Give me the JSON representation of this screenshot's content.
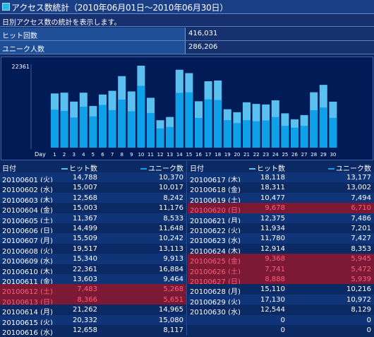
{
  "header": {
    "title": "アクセス数統計（2010年06月01日〜2010年06月30日）",
    "description": "日別アクセス数の統計を表示します。"
  },
  "summary": {
    "hits_label": "ヒット回数",
    "hits_value": "416,031",
    "unique_label": "ユニーク人数",
    "unique_value": "286,206"
  },
  "colors": {
    "hits": "#5ac0f0",
    "unique": "#0ea0e8",
    "highlight": "#7c1a35"
  },
  "chart_data": {
    "type": "bar",
    "ymax_label": "22361",
    "xlabel": "Day",
    "ylim": [
      0,
      22361
    ],
    "categories": [
      "1",
      "2",
      "3",
      "4",
      "5",
      "6",
      "7",
      "8",
      "9",
      "10",
      "11",
      "12",
      "13",
      "14",
      "15",
      "16",
      "17",
      "18",
      "19",
      "20",
      "21",
      "22",
      "23",
      "24",
      "25",
      "26",
      "27",
      "28",
      "29",
      "30"
    ],
    "series": [
      {
        "name": "ヒット数",
        "values": [
          14788,
          15007,
          12568,
          15003,
          11367,
          14499,
          15509,
          19517,
          15340,
          22361,
          13603,
          7483,
          8366,
          21262,
          20332,
          12658,
          18118,
          18311,
          10477,
          9678,
          12375,
          11934,
          11780,
          12914,
          9368,
          7741,
          8888,
          15110,
          17130,
          12544
        ]
      },
      {
        "name": "ユニーク数",
        "values": [
          10370,
          10017,
          8242,
          11176,
          8533,
          11648,
          10242,
          13113,
          9913,
          16884,
          9464,
          5268,
          5651,
          14965,
          15080,
          8117,
          13177,
          13002,
          7494,
          6710,
          7486,
          7201,
          7427,
          8353,
          5945,
          5472,
          5939,
          10216,
          10972,
          8129
        ]
      }
    ]
  },
  "table": {
    "col_date": "日付",
    "col_hits": "ヒット数",
    "col_unique": "ユニーク数",
    "left_rows": [
      {
        "date": "20100601 (火)",
        "hits": "14,788",
        "uniq": "10,370",
        "hl": false
      },
      {
        "date": "20100602 (水)",
        "hits": "15,007",
        "uniq": "10,017",
        "hl": false
      },
      {
        "date": "20100603 (木)",
        "hits": "12,568",
        "uniq": "8,242",
        "hl": false
      },
      {
        "date": "20100604 (金)",
        "hits": "15,003",
        "uniq": "11,176",
        "hl": false
      },
      {
        "date": "20100605 (土)",
        "hits": "11,367",
        "uniq": "8,533",
        "hl": false
      },
      {
        "date": "20100606 (日)",
        "hits": "14,499",
        "uniq": "11,648",
        "hl": false
      },
      {
        "date": "20100607 (月)",
        "hits": "15,509",
        "uniq": "10,242",
        "hl": false
      },
      {
        "date": "20100608 (火)",
        "hits": "19,517",
        "uniq": "13,113",
        "hl": false
      },
      {
        "date": "20100609 (水)",
        "hits": "15,340",
        "uniq": "9,913",
        "hl": false
      },
      {
        "date": "20100610 (木)",
        "hits": "22,361",
        "uniq": "16,884",
        "hl": false
      },
      {
        "date": "20100611 (金)",
        "hits": "13,603",
        "uniq": "9,464",
        "hl": false
      },
      {
        "date": "20100612 (土)",
        "hits": "7,483",
        "uniq": "5,268",
        "hl": true
      },
      {
        "date": "20100613 (日)",
        "hits": "8,366",
        "uniq": "5,651",
        "hl": true
      },
      {
        "date": "20100614 (月)",
        "hits": "21,262",
        "uniq": "14,965",
        "hl": false
      },
      {
        "date": "20100615 (火)",
        "hits": "20,332",
        "uniq": "15,080",
        "hl": false
      },
      {
        "date": "20100616 (水)",
        "hits": "12,658",
        "uniq": "8,117",
        "hl": false
      }
    ],
    "right_rows": [
      {
        "date": "20100617 (木)",
        "hits": "18,118",
        "uniq": "13,177",
        "hl": false
      },
      {
        "date": "20100618 (金)",
        "hits": "18,311",
        "uniq": "13,002",
        "hl": false
      },
      {
        "date": "20100619 (土)",
        "hits": "10,477",
        "uniq": "7,494",
        "hl": false
      },
      {
        "date": "20100620 (日)",
        "hits": "9,678",
        "uniq": "6,710",
        "hl": true
      },
      {
        "date": "20100621 (月)",
        "hits": "12,375",
        "uniq": "7,486",
        "hl": false
      },
      {
        "date": "20100622 (火)",
        "hits": "11,934",
        "uniq": "7,201",
        "hl": false
      },
      {
        "date": "20100623 (水)",
        "hits": "11,780",
        "uniq": "7,427",
        "hl": false
      },
      {
        "date": "20100624 (木)",
        "hits": "12,914",
        "uniq": "8,353",
        "hl": false
      },
      {
        "date": "20100625 (金)",
        "hits": "9,368",
        "uniq": "5,945",
        "hl": true
      },
      {
        "date": "20100626 (土)",
        "hits": "7,741",
        "uniq": "5,472",
        "hl": true
      },
      {
        "date": "20100627 (日)",
        "hits": "8,888",
        "uniq": "5,939",
        "hl": true
      },
      {
        "date": "20100628 (月)",
        "hits": "15,110",
        "uniq": "10,216",
        "hl": false
      },
      {
        "date": "20100629 (火)",
        "hits": "17,130",
        "uniq": "10,972",
        "hl": false
      },
      {
        "date": "20100630 (水)",
        "hits": "12,544",
        "uniq": "8,129",
        "hl": false
      },
      {
        "date": "",
        "hits": "0",
        "uniq": "0",
        "hl": false
      },
      {
        "date": "",
        "hits": "0",
        "uniq": "0",
        "hl": false
      }
    ]
  }
}
